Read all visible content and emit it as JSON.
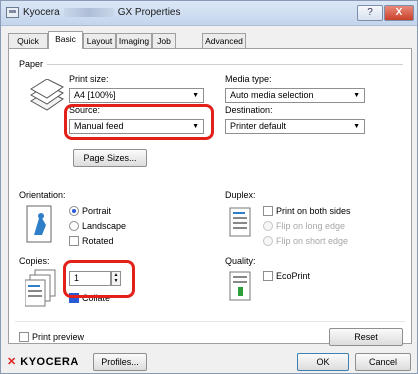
{
  "window": {
    "title_prefix": "Kyocera",
    "title_suffix": "GX Properties",
    "help_label": "?",
    "close_label": "X"
  },
  "tabs": [
    {
      "label": "Quick Print"
    },
    {
      "label": "Basic"
    },
    {
      "label": "Layout"
    },
    {
      "label": "Imaging"
    },
    {
      "label": "Job"
    },
    {
      "label": "Advanced"
    }
  ],
  "active_tab": "Basic",
  "paper": {
    "group_label": "Paper",
    "print_size_label": "Print size:",
    "print_size_value": "A4 [100%]",
    "source_label": "Source:",
    "source_value": "Manual feed",
    "media_type_label": "Media type:",
    "media_type_value": "Auto media selection",
    "destination_label": "Destination:",
    "destination_value": "Printer default",
    "page_sizes_button": "Page Sizes..."
  },
  "orientation": {
    "label": "Orientation:",
    "options": [
      "Portrait",
      "Landscape",
      "Rotated"
    ],
    "selected": "Portrait",
    "rotated_checked": false
  },
  "duplex": {
    "label": "Duplex:",
    "print_both_sides": "Print on both sides",
    "flip_long": "Flip on long edge",
    "flip_short": "Flip on short edge",
    "print_both_sides_checked": false
  },
  "copies": {
    "label": "Copies:",
    "value": "1",
    "collate_label": "Collate",
    "collate_checked": true
  },
  "quality": {
    "label": "Quality:",
    "ecoprint_label": "EcoPrint",
    "ecoprint_checked": false
  },
  "print_preview_label": "Print preview",
  "reset_button": "Reset",
  "footer": {
    "logo_text": "KYOCERA",
    "profiles_button": "Profiles...",
    "ok_button": "OK",
    "cancel_button": "Cancel"
  },
  "colors": {
    "highlight": "#e3211b",
    "selection_blue": "#2a5bd6"
  }
}
